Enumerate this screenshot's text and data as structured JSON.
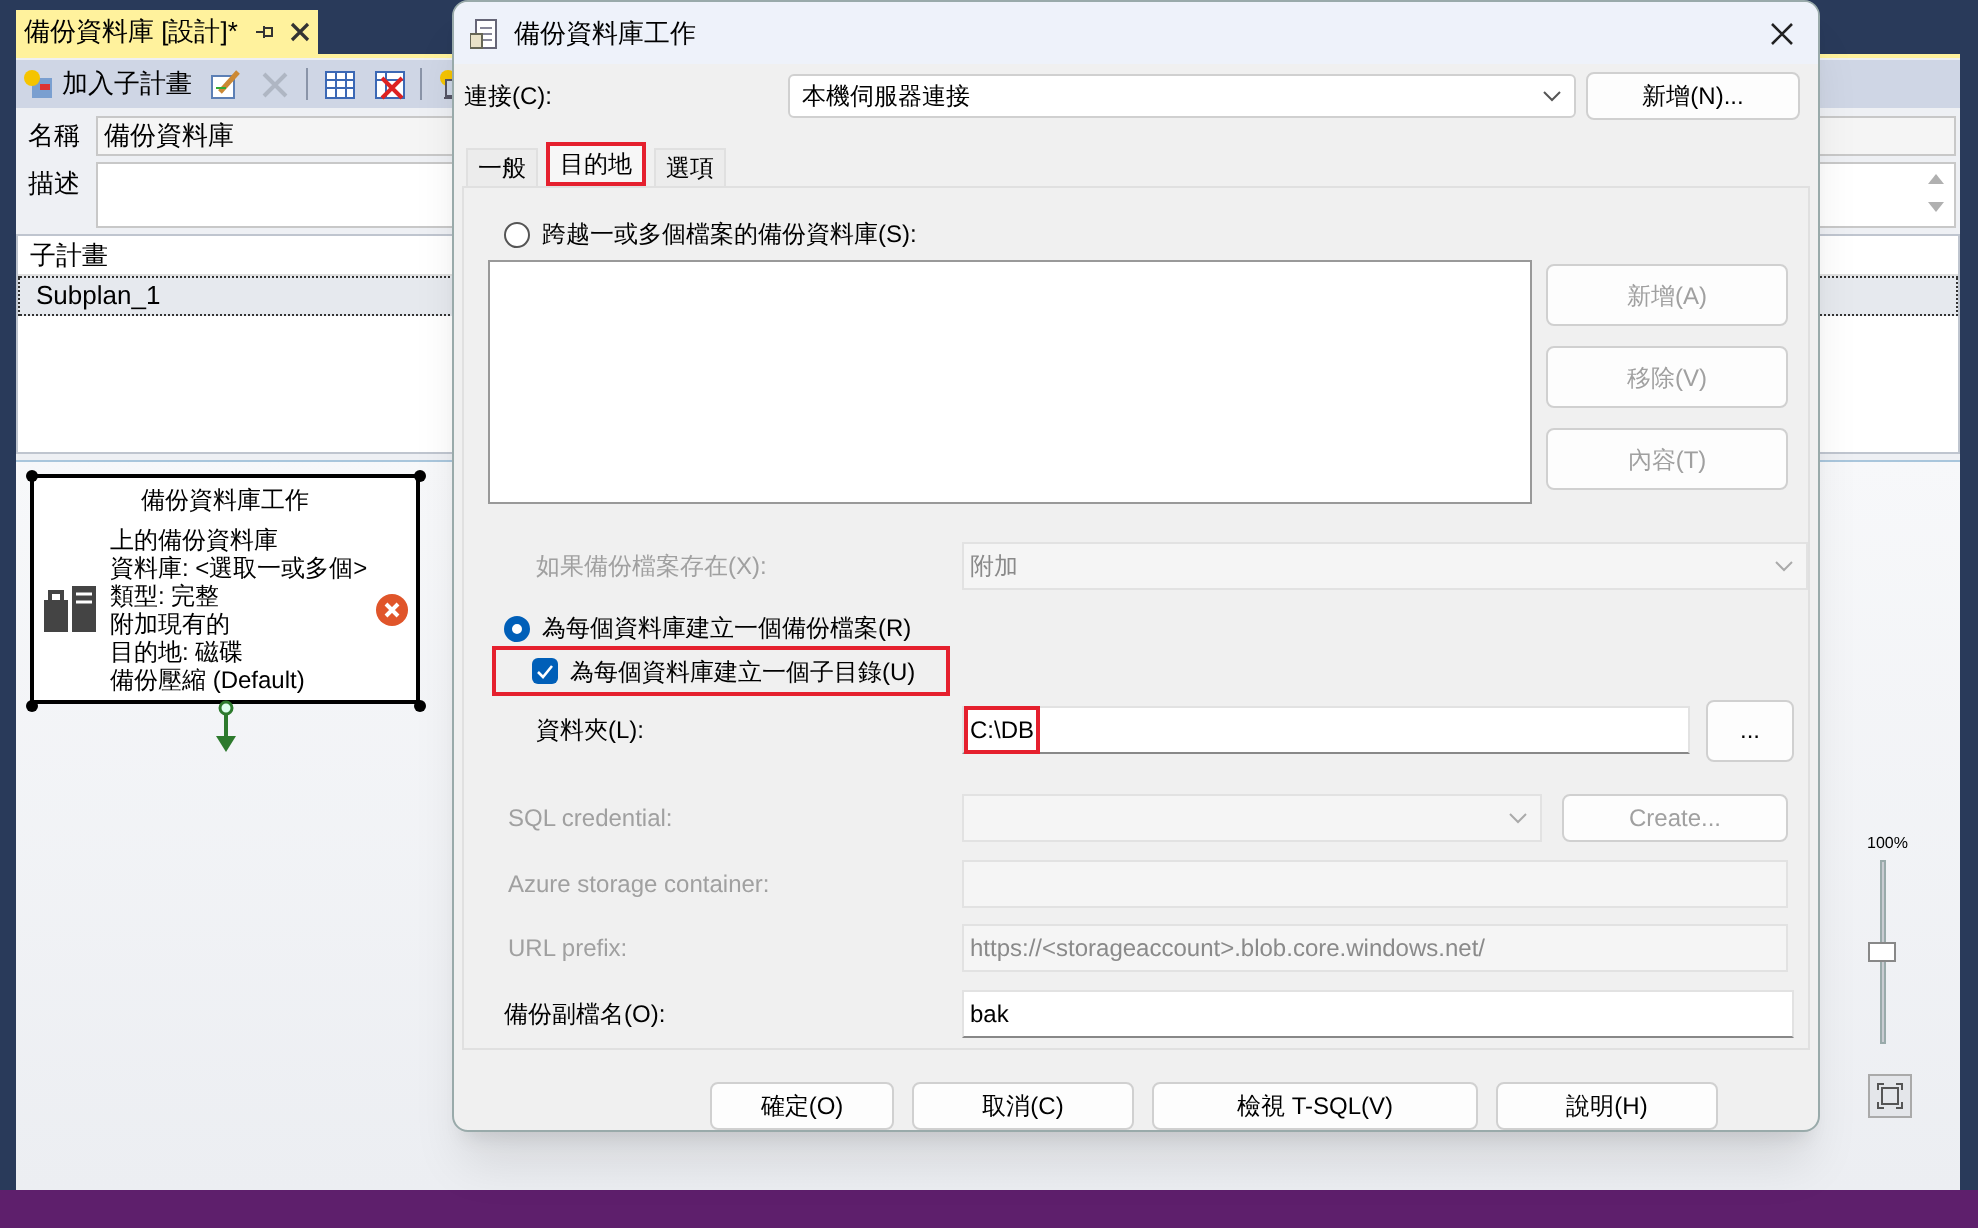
{
  "designer": {
    "tab": {
      "title": "備份資料庫 [設計]*"
    },
    "toolbar": [
      {
        "kind": "add",
        "label": "加入子計畫",
        "disabled": false
      },
      {
        "kind": "edit",
        "disabled": false
      },
      {
        "kind": "delete",
        "disabled": true
      },
      {
        "kind": "grid",
        "disabled": false
      },
      {
        "kind": "grid-delete",
        "disabled": false
      },
      {
        "kind": "manage",
        "disabled": false
      }
    ],
    "name_label": "名稱",
    "name_value": "備份資料庫",
    "description_label": "描述",
    "subplans": {
      "header": "子計畫",
      "rows": [
        {
          "name": "Subplan_1",
          "selected": true
        }
      ]
    },
    "task": {
      "title": "備份資料庫工作",
      "lines": [
        "上的備份資料庫",
        "資料庫: <選取一或多個>",
        "類型: 完整",
        "附加現有的",
        "目的地: 磁碟",
        "備份壓縮 (Default)"
      ],
      "error": true
    },
    "zoom": {
      "label": "100%",
      "level": 0.5
    }
  },
  "dialog": {
    "title": "備份資料庫工作",
    "connection": {
      "label": "連接(C):",
      "value": "本機伺服器連接",
      "new_button": "新增(N)..."
    },
    "tabs": [
      {
        "label": "一般",
        "selected": false,
        "highlighted": false
      },
      {
        "label": "目的地",
        "selected": true,
        "highlighted": true
      },
      {
        "label": "選項",
        "selected": false,
        "highlighted": false
      }
    ],
    "across_files": {
      "label": "跨越一或多個檔案的備份資料庫(S):",
      "selected": false
    },
    "list_buttons": [
      {
        "label": "新增(A)",
        "disabled": true
      },
      {
        "label": "移除(V)",
        "disabled": true
      },
      {
        "label": "內容(T)",
        "disabled": true
      }
    ],
    "if_exists": {
      "label": "如果備份檔案存在(X):",
      "value": "附加",
      "disabled": true
    },
    "per_database": {
      "label": "為每個資料庫建立一個備份檔案(R)",
      "selected": true
    },
    "subdirectory": {
      "label": "為每個資料庫建立一個子目錄(U)",
      "checked": true,
      "highlighted": true
    },
    "folder": {
      "label": "資料夾(L):",
      "value": "C:\\DB",
      "highlighted": true,
      "browse_button": "..."
    },
    "sql_credential": {
      "label": "SQL credential:",
      "disabled": true,
      "create_button": "Create..."
    },
    "azure_container": {
      "label": "Azure storage container:",
      "disabled": true
    },
    "url_prefix": {
      "label": "URL prefix:",
      "value": "https://<storageaccount>.blob.core.windows.net/",
      "disabled": true
    },
    "extension": {
      "label": "備份副檔名(O):",
      "value": "bak"
    },
    "buttons": [
      "確定(O)",
      "取消(C)",
      "檢視 T-SQL(V)",
      "說明(H)"
    ]
  }
}
